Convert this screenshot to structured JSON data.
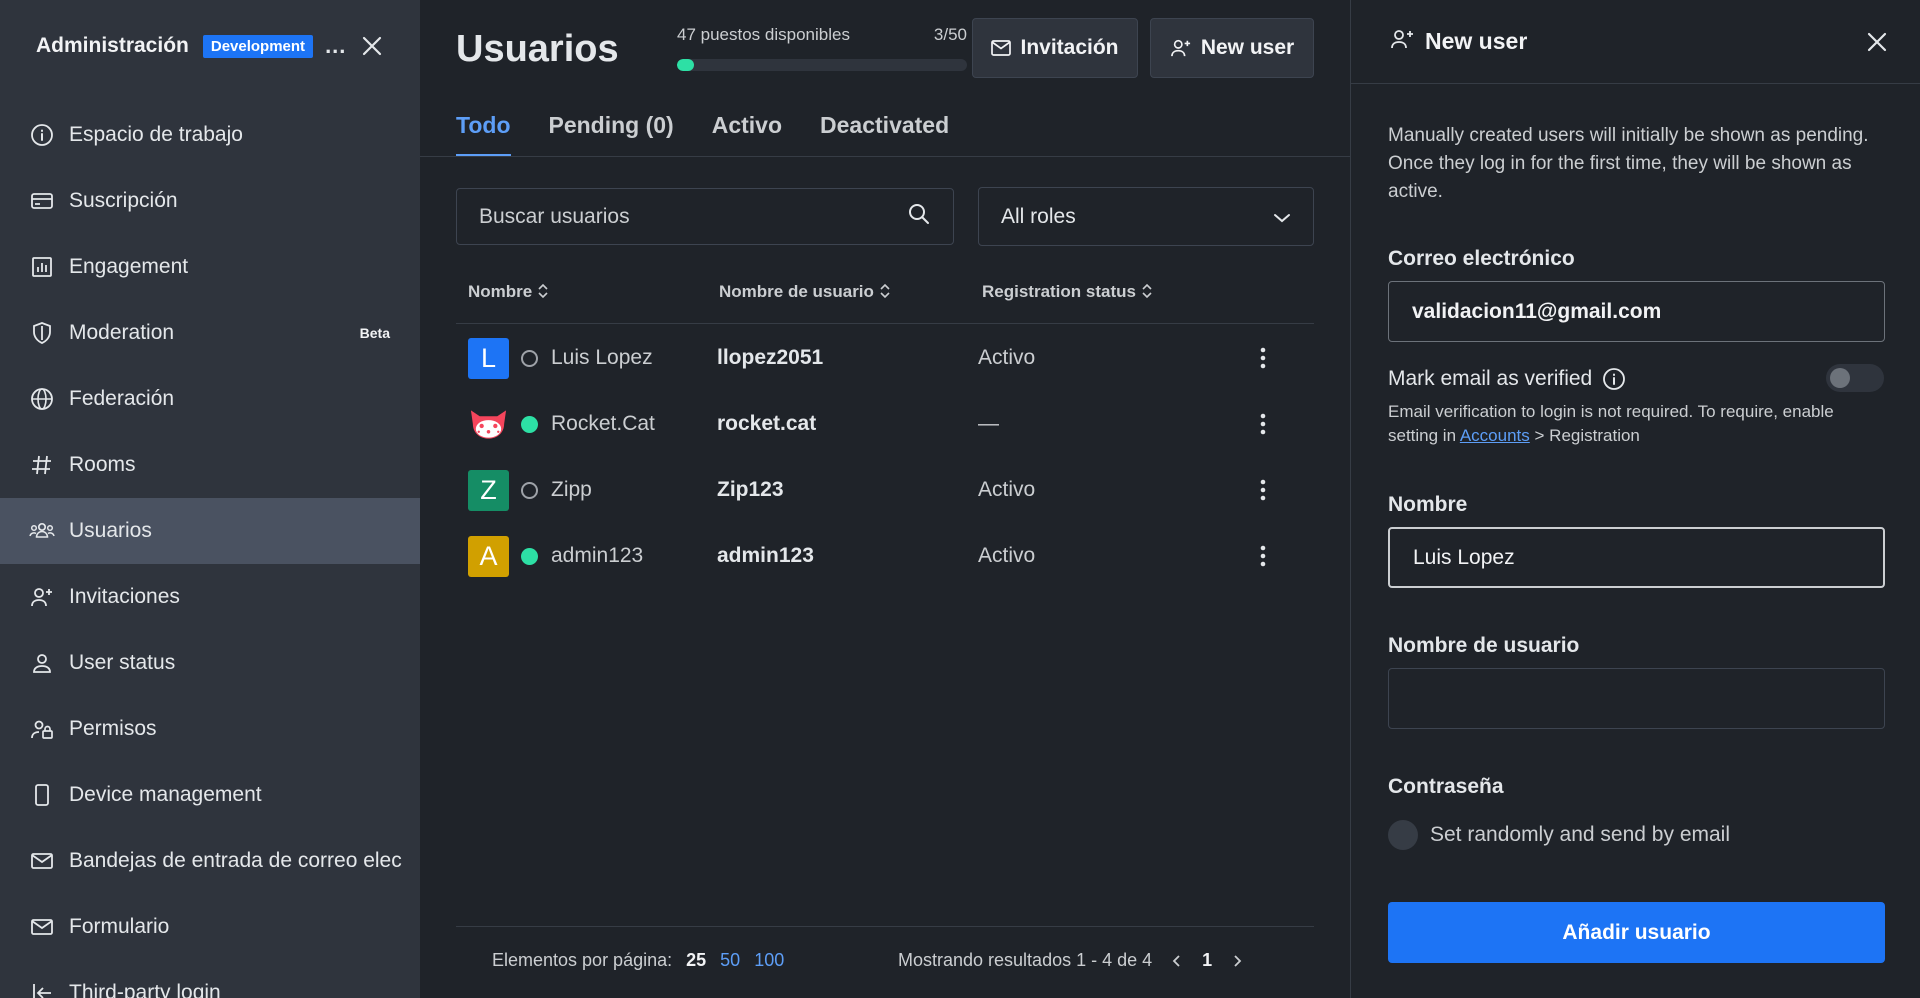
{
  "sidebar": {
    "title": "Administración",
    "badge": "Development",
    "more": "...",
    "items": [
      {
        "label": "Espacio de trabajo",
        "icon": "info-circle-icon"
      },
      {
        "label": "Suscripción",
        "icon": "card-icon"
      },
      {
        "label": "Engagement",
        "icon": "bar-chart-icon"
      },
      {
        "label": "Moderation",
        "icon": "shield-icon",
        "badge": "Beta"
      },
      {
        "label": "Federación",
        "icon": "globe-icon"
      },
      {
        "label": "Rooms",
        "icon": "hashtag-icon"
      },
      {
        "label": "Usuarios",
        "icon": "team-icon",
        "active": true
      },
      {
        "label": "Invitaciones",
        "icon": "user-plus-icon"
      },
      {
        "label": "User status",
        "icon": "user-icon"
      },
      {
        "label": "Permisos",
        "icon": "user-lock-icon"
      },
      {
        "label": "Device management",
        "icon": "mobile-icon"
      },
      {
        "label": "Bandejas de entrada de correo elec",
        "icon": "mail-icon"
      },
      {
        "label": "Formulario",
        "icon": "mail-icon"
      },
      {
        "label": "Third-party login",
        "icon": "login-icon"
      }
    ]
  },
  "main": {
    "title": "Usuarios",
    "seats": {
      "available": "47 puestos disponibles",
      "count": "3/50",
      "fraction": 0.06
    },
    "invite_button": "Invitación",
    "new_user_button": "New user",
    "tabs": [
      {
        "label": "Todo",
        "active": true
      },
      {
        "label": "Pending (0)"
      },
      {
        "label": "Activo"
      },
      {
        "label": "Deactivated"
      }
    ],
    "search_placeholder": "Buscar usuarios",
    "roles_select": "All roles",
    "columns": [
      "Nombre",
      "Nombre de usuario",
      "Registration status"
    ],
    "rows": [
      {
        "avatar": "L",
        "avatar_color": "#1d74f5",
        "presence": "offline",
        "name": "Luis Lopez",
        "username": "llopez2051",
        "status": "Activo"
      },
      {
        "avatar": "rocket-cat",
        "avatar_color": "#f5455c",
        "presence": "online",
        "name": "Rocket.Cat",
        "username": "rocket.cat",
        "status": "—"
      },
      {
        "avatar": "Z",
        "avatar_color": "#158d65",
        "presence": "offline",
        "name": "Zipp",
        "username": "Zip123",
        "status": "Activo"
      },
      {
        "avatar": "A",
        "avatar_color": "#d1a000",
        "presence": "online",
        "name": "admin123",
        "username": "admin123",
        "status": "Activo"
      }
    ],
    "pager": {
      "per_page_label": "Elementos por página:",
      "per_page_options": [
        "25",
        "50",
        "100"
      ],
      "per_page_selected": "25",
      "showing": "Mostrando resultados 1 - 4 de 4",
      "page": "1"
    }
  },
  "panel": {
    "title": "New user",
    "description": "Manually created users will initially be shown as pending. Once they log in for the first time, they will be shown as active.",
    "email_label": "Correo electrónico",
    "email_value": "validacion11@gmail.com",
    "verified_label": "Mark email as verified",
    "verified_on": false,
    "hint_prefix": "Email verification to login is not required. To require, enable setting in",
    "hint_link": "Accounts",
    "hint_suffix": "> Registration",
    "name_label": "Nombre",
    "name_value": "Luis Lopez",
    "username_label": "Nombre de usuario",
    "username_value": "",
    "password_label": "Contraseña",
    "password_option": "Set randomly and send by email",
    "submit": "Añadir usuario"
  },
  "colors": {
    "accent": "#1d74f5",
    "link": "#5d9ef7",
    "online": "#2de0a5",
    "sidebar_bg": "#2f343d",
    "active_item": "#4a5261"
  }
}
